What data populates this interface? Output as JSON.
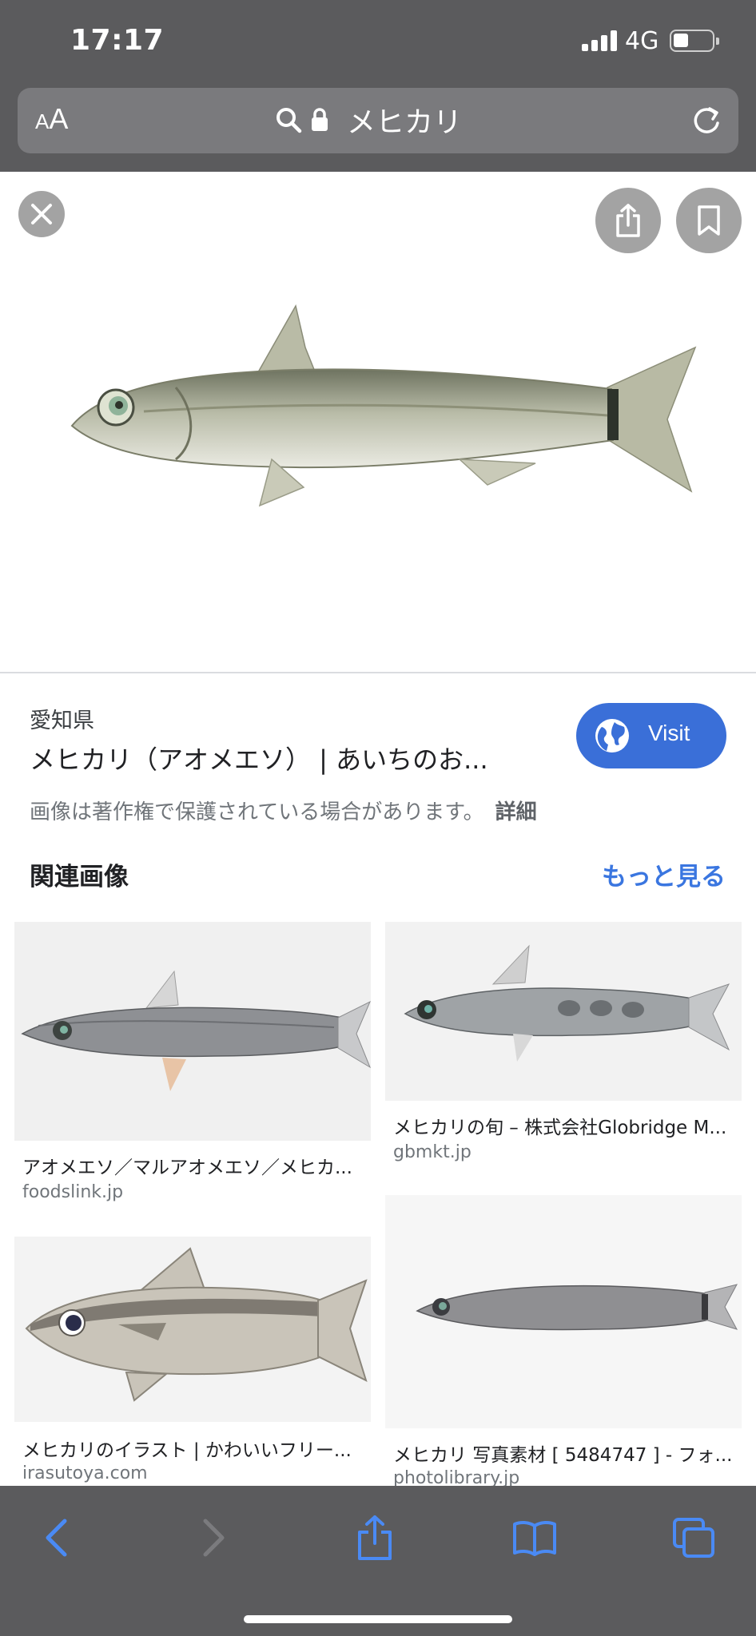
{
  "status_bar": {
    "time": "17:17",
    "network": "4G"
  },
  "address_bar": {
    "text_size_small": "A",
    "text_size_big": "A",
    "query": "メヒカリ"
  },
  "result": {
    "source": "愛知県",
    "title": "メヒカリ（アオメエソ） | あいちのお...",
    "visit_label": "Visit",
    "copyright_notice": "画像は著作権で保護されている場合があります。",
    "details_link": "詳細"
  },
  "related": {
    "heading": "関連画像",
    "more_link": "もっと見る",
    "items": [
      {
        "title": "アオメエソ／マルアオメエソ／メヒカ...",
        "site": "foodslink.jp"
      },
      {
        "title": "メヒカリの旬 – 株式会社Globridge M...",
        "site": "gbmkt.jp"
      },
      {
        "title": "メヒカリのイラスト | かわいいフリー...",
        "site": "irasutoya.com"
      },
      {
        "title": "メヒカリ 写真素材 [ 5484747 ] - フォ...",
        "site": "photolibrary.jp"
      }
    ]
  },
  "colors": {
    "chrome": "#5b5b5d",
    "accent": "#3a6fd8",
    "link": "#3a76e0",
    "toolbar_icon": "#4a8af4"
  }
}
